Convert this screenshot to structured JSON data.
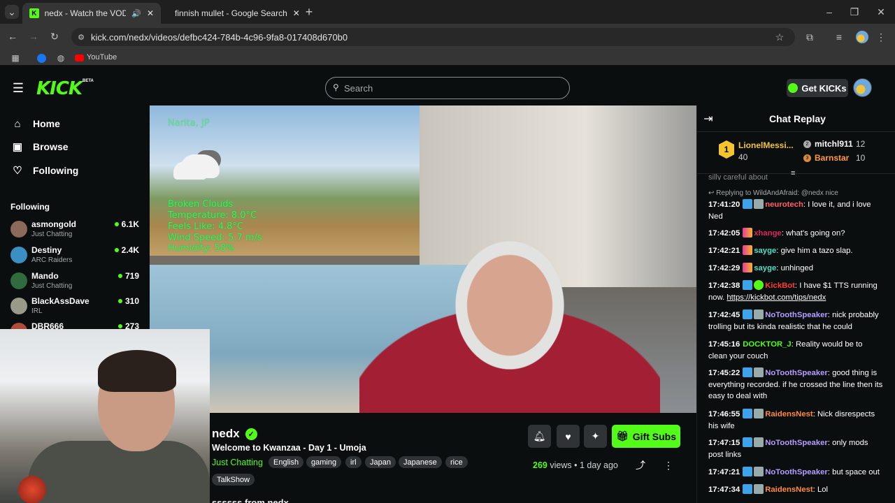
{
  "browser": {
    "tabs": [
      {
        "title": "nedx - Watch the VOD on K"
      },
      {
        "title": "finnish mullet - Google Search"
      }
    ],
    "url": "kick.com/nedx/videos/defbc424-784b-4c96-9fa8-017408d670b0",
    "bookmark": "YouTube"
  },
  "header": {
    "search_placeholder": "Search",
    "get_kicks": "Get KICKs",
    "logo": "KICK",
    "beta": "BETA"
  },
  "sidebar": {
    "nav": [
      {
        "label": "Home",
        "icon": "home-icon"
      },
      {
        "label": "Browse",
        "icon": "browse-icon"
      },
      {
        "label": "Following",
        "icon": "heart-icon"
      }
    ],
    "following_title": "Following",
    "channels": [
      {
        "name": "asmongold",
        "category": "Just Chatting",
        "viewers": "6.1K"
      },
      {
        "name": "Destiny",
        "category": "ARC Raiders",
        "viewers": "2.4K"
      },
      {
        "name": "Mando",
        "category": "Just Chatting",
        "viewers": "719"
      },
      {
        "name": "BlackAssDave",
        "category": "IRL",
        "viewers": "310"
      },
      {
        "name": "DBR666",
        "category": "",
        "viewers": "273"
      }
    ]
  },
  "video": {
    "weather": {
      "location": "Narita, JP",
      "conditions": "Broken Clouds",
      "temperature": "Temperature: 8.0°C",
      "feels": "Feels Like: 4.8°C",
      "wind": "Wind Speed: 5.7 m/s",
      "humidity": "Humidity: 58%"
    }
  },
  "stream": {
    "channel": "nedx",
    "title": "Welcome to Kwanzaa - Day 1 - Umoja",
    "category": "Just Chatting",
    "tags": [
      "English",
      "gaming",
      "irl",
      "Japan",
      "Japanese",
      "rice",
      "TalkShow"
    ],
    "views": "269",
    "views_label": "views",
    "age": "1 day ago",
    "gift_subs": "Gift Subs",
    "below": "ssssss from nedx"
  },
  "chat": {
    "title": "Chat Replay",
    "leaderboard": [
      {
        "rank": "1",
        "name": "LionelMessi...",
        "count": "40"
      },
      {
        "rank": "2",
        "name": "mitchl911",
        "count": "12"
      },
      {
        "rank": "3",
        "name": "Barnstar",
        "count": "10"
      }
    ],
    "partial_line": "silly careful about tonight",
    "reply_to": "Replying to WildAndAfraid: @nedx nice",
    "messages": [
      {
        "time": "17:41:20",
        "user": "neurotech",
        "color": "#ff5f6b",
        "text": "I love it, and i love Ned"
      },
      {
        "time": "17:42:05",
        "user": "xhange",
        "color": "#e0245e",
        "text": "what's going on?"
      },
      {
        "time": "17:42:21",
        "user": "sayge",
        "color": "#4de0c6",
        "text": "give him a tazo slap."
      },
      {
        "time": "17:42:29",
        "user": "sayge",
        "color": "#4de0c6",
        "text": "unhinged"
      },
      {
        "time": "17:42:38",
        "user": "KickBot",
        "color": "#ff3b30",
        "text": "I have $1 TTS running now.",
        "link": "https://kickbot.com/tips/nedx"
      },
      {
        "time": "17:42:45",
        "user": "NoToothSpeaker",
        "color": "#b79cff",
        "text": "nick probably trolling but its kinda realistic that he could"
      },
      {
        "time": "17:45:16",
        "user": "DOCKTOR_J",
        "color": "#53fc18",
        "text": "Reality would be to clean your couch"
      },
      {
        "time": "17:45:22",
        "user": "NoToothSpeaker",
        "color": "#b79cff",
        "text": "good thing is everything recorded. if he crossed the line then its easy to deal with"
      },
      {
        "time": "17:46:55",
        "user": "RaidensNest",
        "color": "#ff8a3d",
        "text": "Nick disrespects his wife"
      },
      {
        "time": "17:47:15",
        "user": "NoToothSpeaker",
        "color": "#b79cff",
        "text": "only mods post links"
      },
      {
        "time": "17:47:21",
        "user": "NoToothSpeaker",
        "color": "#b79cff",
        "text": "but space out"
      },
      {
        "time": "17:47:34",
        "user": "RaidensNest",
        "color": "#ff8a3d",
        "text": "Lol"
      }
    ]
  }
}
